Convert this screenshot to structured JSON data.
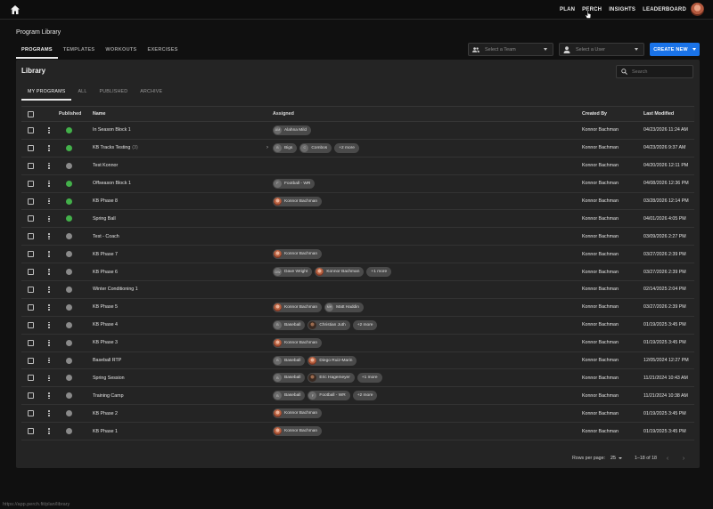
{
  "topbar": {
    "nav": [
      "PLAN",
      "PERCH",
      "INSIGHTS",
      "LEADERBOARD"
    ],
    "home_icon": "home-icon",
    "avatar_icon": "user-avatar"
  },
  "page": {
    "title": "Program Library",
    "tabs": [
      "PROGRAMS",
      "TEMPLATES",
      "WORKOUTS",
      "EXERCISES"
    ],
    "active_tab": "PROGRAMS",
    "team_select": {
      "placeholder": "Select a Team",
      "icon": "group-icon"
    },
    "user_select": {
      "placeholder": "Select a User",
      "icon": "person-icon"
    },
    "create_button": "CREATE NEW",
    "accent": "#1a73e8"
  },
  "library": {
    "title": "Library",
    "search_placeholder": "Search",
    "subtabs": [
      "MY PROGRAMS",
      "ALL",
      "PUBLISHED",
      "ARCHIVE"
    ],
    "active_subtab": "MY PROGRAMS",
    "columns": {
      "published": "Published",
      "name": "Name",
      "assigned": "Assigned",
      "created_by": "Created By",
      "last_modified": "Last Modified"
    },
    "published_color": "#43b04a",
    "unpublished_color": "#8a8a8a",
    "rows": [
      {
        "published": true,
        "name": "In Season Block 1",
        "count": "",
        "expand": "",
        "assigned": [
          {
            "type": "ini",
            "ini": "AM",
            "label": "Alahna Mild"
          }
        ],
        "created_by": "Konnor Bachman",
        "modified": "04/23/2026 11:24 AM"
      },
      {
        "published": true,
        "name": "KB Tracks Testing",
        "count": "(3)",
        "expand": "›",
        "assigned": [
          {
            "type": "ini",
            "ini": "B",
            "label": "Bigs"
          },
          {
            "type": "ini",
            "ini": "C",
            "label": "Combos"
          },
          {
            "type": "more",
            "label": "+2 more"
          }
        ],
        "created_by": "Konnor Bachman",
        "modified": "04/23/2026 9:37 AM"
      },
      {
        "published": false,
        "name": "Test Konnor",
        "count": "",
        "expand": "",
        "assigned": [],
        "created_by": "Konnor Bachman",
        "modified": "04/20/2026 12:11 PM"
      },
      {
        "published": true,
        "name": "Offseason Block 1",
        "count": "",
        "expand": "",
        "assigned": [
          {
            "type": "ini",
            "ini": "F",
            "label": "Football - WR"
          }
        ],
        "created_by": "Konnor Bachman",
        "modified": "04/08/2026 12:36 PM"
      },
      {
        "published": true,
        "name": "KB Phase 8",
        "count": "",
        "expand": "",
        "assigned": [
          {
            "type": "photo",
            "label": "Konnor Bachman"
          }
        ],
        "created_by": "Konnor Bachman",
        "modified": "03/28/2026 12:14 PM"
      },
      {
        "published": true,
        "name": "Spring Ball",
        "count": "",
        "expand": "",
        "assigned": [],
        "created_by": "Konnor Bachman",
        "modified": "04/01/2026 4:05 PM"
      },
      {
        "published": false,
        "name": "Test - Coach",
        "count": "",
        "expand": "",
        "assigned": [],
        "created_by": "Konnor Bachman",
        "modified": "03/09/2026 2:27 PM"
      },
      {
        "published": false,
        "name": "KB Phase 7",
        "count": "",
        "expand": "",
        "assigned": [
          {
            "type": "photo",
            "label": "Konnor Bachman"
          }
        ],
        "created_by": "Konnor Bachman",
        "modified": "03/27/2026 2:39 PM"
      },
      {
        "published": false,
        "name": "KB Phase 6",
        "count": "",
        "expand": "",
        "assigned": [
          {
            "type": "ini",
            "ini": "DW",
            "label": "Dave Wright"
          },
          {
            "type": "photo",
            "label": "Konnor Bachman"
          },
          {
            "type": "more",
            "label": "+1 more"
          }
        ],
        "created_by": "Konnor Bachman",
        "modified": "03/27/2026 2:39 PM"
      },
      {
        "published": false,
        "name": "Winter Conditioning 1",
        "count": "",
        "expand": "",
        "assigned": [],
        "created_by": "Konnor Bachman",
        "modified": "02/14/2025 2:04 PM"
      },
      {
        "published": false,
        "name": "KB Phase 5",
        "count": "",
        "expand": "",
        "assigned": [
          {
            "type": "photo",
            "label": "Konnor Bachman"
          },
          {
            "type": "ini",
            "ini": "MH",
            "label": "Matt Haddin"
          }
        ],
        "created_by": "Konnor Bachman",
        "modified": "03/27/2026 2:39 PM"
      },
      {
        "published": false,
        "name": "KB Phase 4",
        "count": "",
        "expand": "",
        "assigned": [
          {
            "type": "ini",
            "ini": "B",
            "label": "Baseball"
          },
          {
            "type": "dark",
            "label": "Christian Juth"
          },
          {
            "type": "more",
            "label": "+2 more"
          }
        ],
        "created_by": "Konnor Bachman",
        "modified": "01/19/2025 3:45 PM"
      },
      {
        "published": false,
        "name": "KB Phase 3",
        "count": "",
        "expand": "",
        "assigned": [
          {
            "type": "photo",
            "label": "Konnor Bachman"
          }
        ],
        "created_by": "Konnor Bachman",
        "modified": "01/19/2025 3:45 PM"
      },
      {
        "published": false,
        "name": "Baseball RTP",
        "count": "",
        "expand": "",
        "assigned": [
          {
            "type": "ini",
            "ini": "B",
            "label": "Baseball"
          },
          {
            "type": "photo",
            "label": "Diego Ruiz-Marin"
          }
        ],
        "created_by": "Konnor Bachman",
        "modified": "12/05/2024 12:27 PM"
      },
      {
        "published": false,
        "name": "Spring Session",
        "count": "",
        "expand": "",
        "assigned": [
          {
            "type": "ini",
            "ini": "B",
            "label": "Baseball"
          },
          {
            "type": "dark",
            "label": "Eric Hagemeyer"
          },
          {
            "type": "more",
            "label": "+1 more"
          }
        ],
        "created_by": "Konnor Bachman",
        "modified": "11/21/2024 10:43 AM"
      },
      {
        "published": false,
        "name": "Training Camp",
        "count": "",
        "expand": "",
        "assigned": [
          {
            "type": "ini",
            "ini": "B",
            "label": "Baseball"
          },
          {
            "type": "ini",
            "ini": "F",
            "label": "Football - WR"
          },
          {
            "type": "more",
            "label": "+2 more"
          }
        ],
        "created_by": "Konnor Bachman",
        "modified": "11/21/2024 10:38 AM"
      },
      {
        "published": false,
        "name": "KB Phase 2",
        "count": "",
        "expand": "",
        "assigned": [
          {
            "type": "photo",
            "label": "Konnor Bachman"
          }
        ],
        "created_by": "Konnor Bachman",
        "modified": "01/19/2025 3:45 PM"
      },
      {
        "published": false,
        "name": "KB Phase 1",
        "count": "",
        "expand": "",
        "assigned": [
          {
            "type": "photo",
            "label": "Konnor Bachman"
          }
        ],
        "created_by": "Konnor Bachman",
        "modified": "01/19/2025 3:45 PM"
      }
    ],
    "footer": {
      "rows_per_page_label": "Rows per page:",
      "rows_per_page": "25",
      "range": "1–18 of 18"
    }
  },
  "status_url": "https://app.perch.fit/plan/library"
}
